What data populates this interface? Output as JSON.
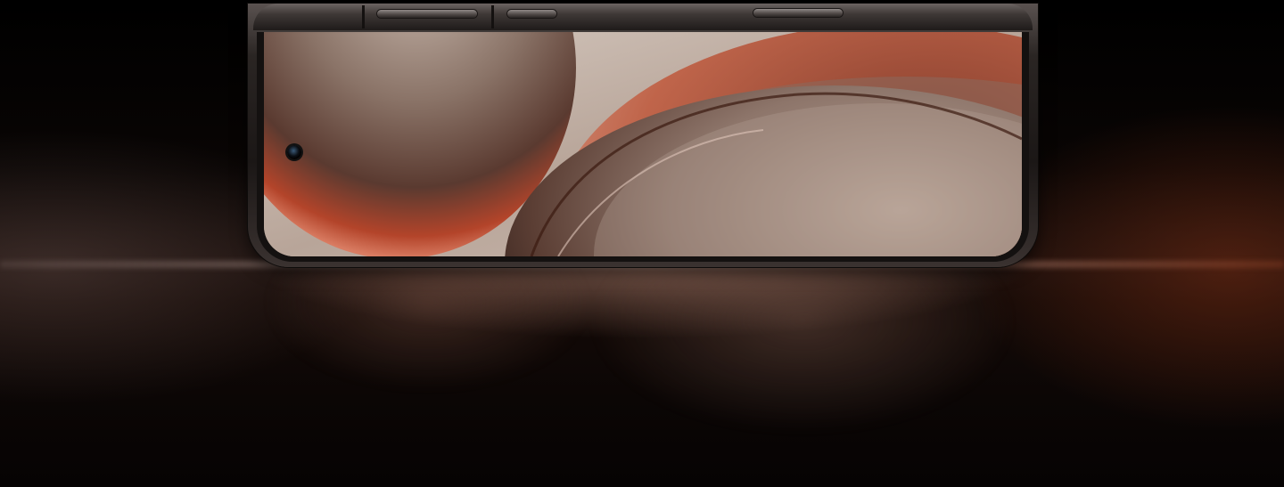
{
  "scene": {
    "subject": "smartphone-front-view",
    "colors": {
      "background": "#050303",
      "accent": "#c25a3c",
      "frame": "#2a2523",
      "screen_light": "#cdbfb5"
    }
  }
}
